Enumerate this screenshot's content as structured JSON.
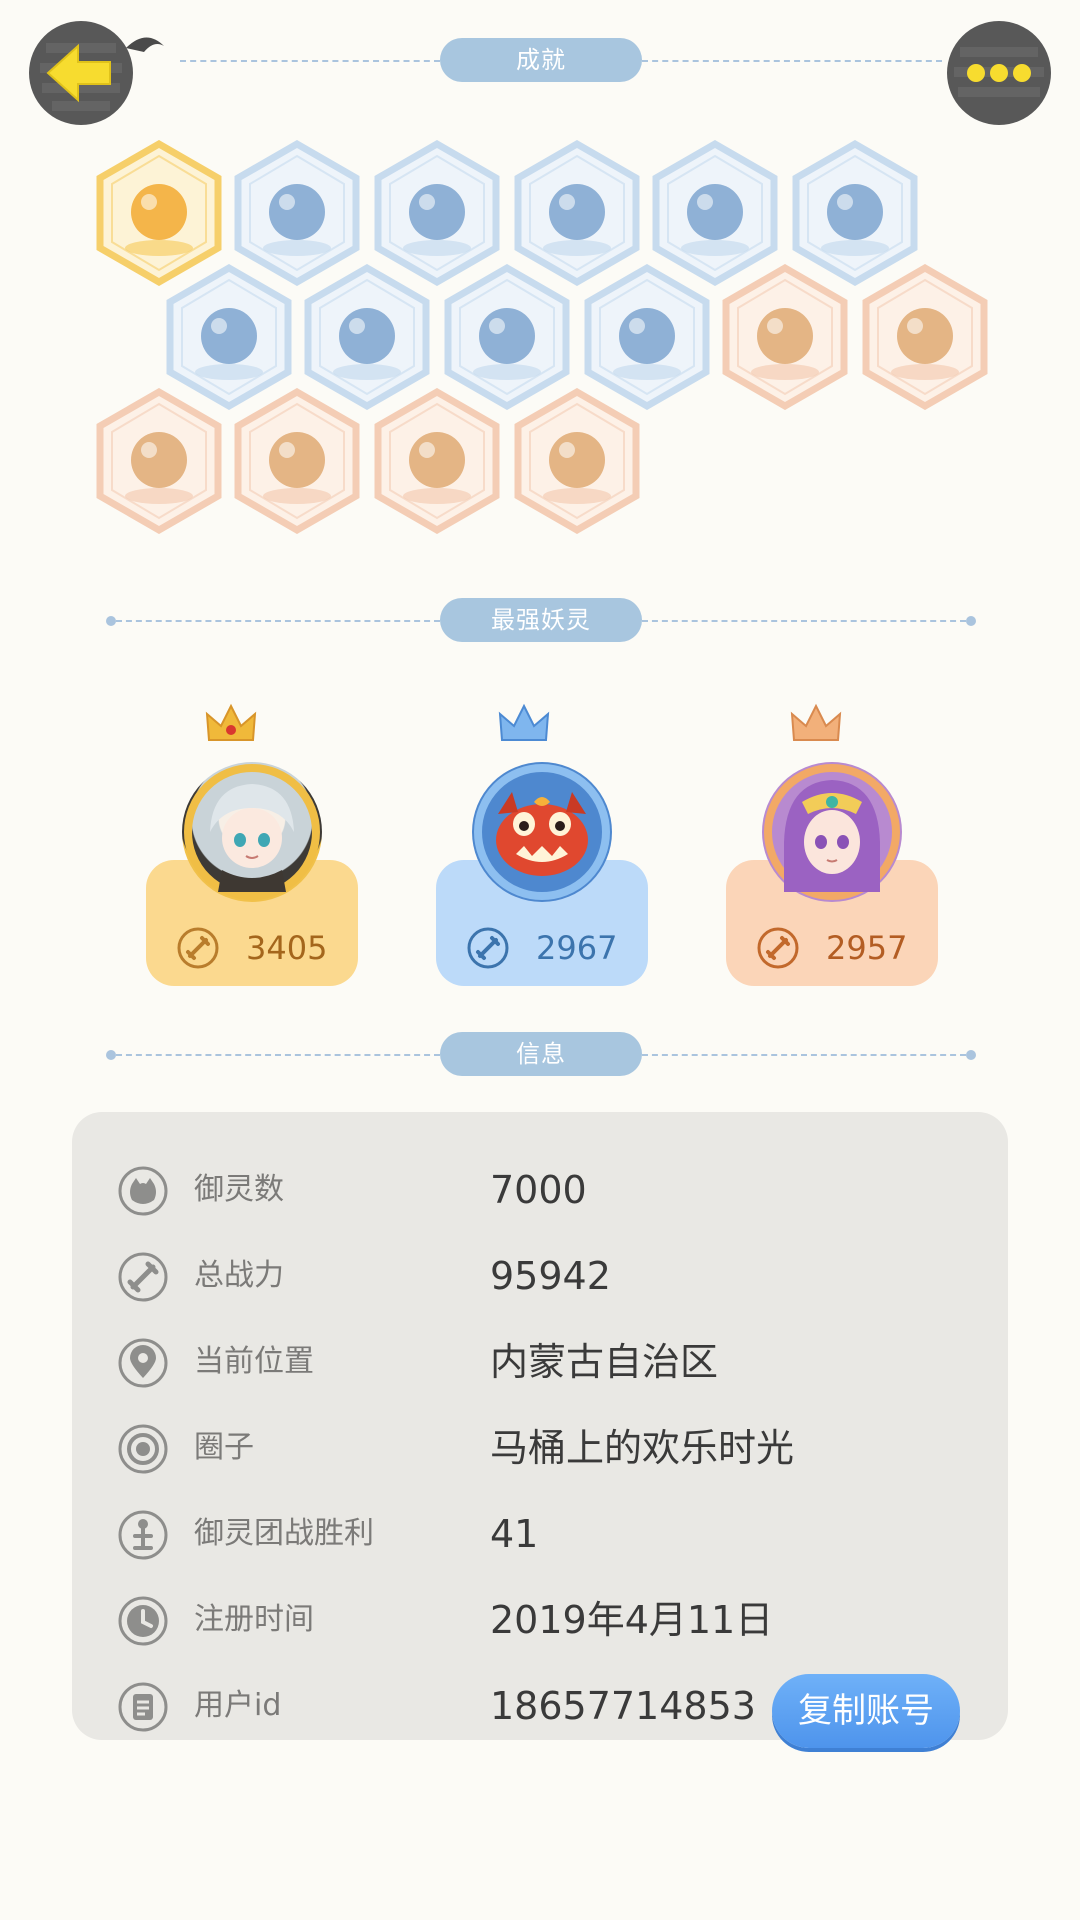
{
  "header": {
    "back_icon": "arrow-left-icon",
    "more_icon": "more-dots-icon"
  },
  "sections": {
    "achievements": "成就",
    "strongest": "最强妖灵",
    "info": "信息"
  },
  "achievements": {
    "badges": [
      {
        "name": "fox-face-badge",
        "tier": "gold"
      },
      {
        "name": "sneaker-badge",
        "tier": "blue"
      },
      {
        "name": "portal-target-badge",
        "tier": "blue"
      },
      {
        "name": "moon-planet-badge",
        "tier": "blue"
      },
      {
        "name": "crystal-ball-badge",
        "tier": "blue"
      },
      {
        "name": "crystal-gem-badge",
        "tier": "blue"
      },
      {
        "name": "yin-yang-wave-badge",
        "tier": "blue"
      },
      {
        "name": "cat-spirit-badge",
        "tier": "blue"
      },
      {
        "name": "yin-yang-card-badge",
        "tier": "blue"
      },
      {
        "name": "shield-portal-badge",
        "tier": "blue"
      },
      {
        "name": "fire-spirit-badge",
        "tier": "orange"
      },
      {
        "name": "cat-cart-badge",
        "tier": "orange"
      },
      {
        "name": "koi-fish-badge",
        "tier": "orange"
      },
      {
        "name": "bull-statue-badge",
        "tier": "orange"
      },
      {
        "name": "twin-cats-badge",
        "tier": "orange"
      },
      {
        "name": "fox-book-badge",
        "tier": "orange"
      }
    ],
    "colors": {
      "gold": "#f6cf6a",
      "blue": "#c7dbee",
      "orange": "#f4cdb5"
    }
  },
  "strongest": {
    "spirits": [
      {
        "name": "silver-haired-girl",
        "power": "3405",
        "crown": "gold",
        "card_color": "#fbd98f",
        "text_color": "#a4661c",
        "icon_color": "#b97d2c"
      },
      {
        "name": "red-crab",
        "power": "2967",
        "crown": "blue",
        "card_color": "#bcdaf9",
        "text_color": "#3c74ad",
        "icon_color": "#3c74ad"
      },
      {
        "name": "purple-haired-priestess",
        "power": "2957",
        "crown": "bronze",
        "card_color": "#fbd5b8",
        "text_color": "#b35d23",
        "icon_color": "#c2692c"
      }
    ]
  },
  "info": {
    "rows": [
      {
        "icon": "spirit-head-icon",
        "label": "御灵数",
        "value": "7000"
      },
      {
        "icon": "sword-circle-icon",
        "label": "总战力",
        "value": "95942"
      },
      {
        "icon": "location-pin-icon",
        "label": "当前位置",
        "value": "内蒙古自治区"
      },
      {
        "icon": "target-circle-icon",
        "label": "圈子",
        "value": "马桶上的欢乐时光"
      },
      {
        "icon": "pawn-figure-icon",
        "label": "御灵团战胜利",
        "value": "41"
      },
      {
        "icon": "clock-icon",
        "label": "注册时间",
        "value": "2019年4月11日"
      },
      {
        "icon": "document-icon",
        "label": "用户id",
        "value": "18657714853"
      }
    ],
    "copy_button": "复制账号"
  }
}
